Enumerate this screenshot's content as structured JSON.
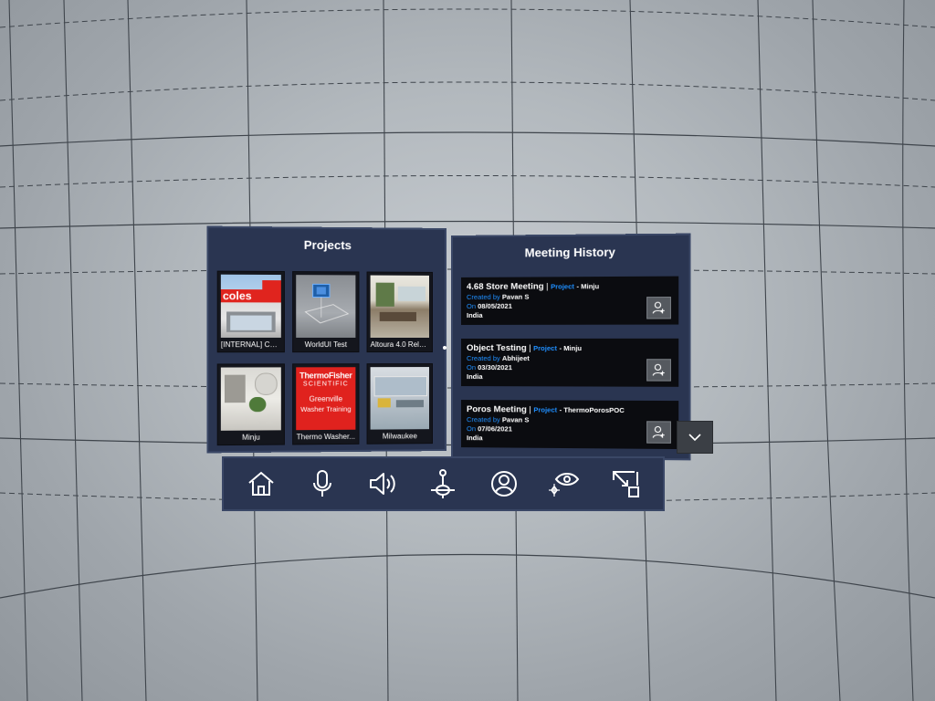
{
  "projects": {
    "title": "Projects",
    "items": [
      {
        "label": "[INTERNAL] Col...",
        "thumb": "coles-store-thumbnail"
      },
      {
        "label": "WorldUI Test",
        "thumb": "worldui-test-thumbnail"
      },
      {
        "label": "Altoura 4.0 Rele...",
        "thumb": "office-interior-thumbnail"
      },
      {
        "label": "Minju",
        "thumb": "room-interior-thumbnail"
      },
      {
        "label": "Thermo Washer...",
        "thumb": "thermo-fisher-thumbnail",
        "logo_line1": "ThermoFisher",
        "logo_line2": "SCIENTIFIC",
        "logo_line3": "Greenville",
        "logo_line4": "Washer Training"
      },
      {
        "label": "Milwaukee",
        "thumb": "office-room-thumbnail"
      }
    ],
    "coles_text": "coles"
  },
  "meetings": {
    "title": "Meeting History",
    "project_label": "Project",
    "created_label": "Created by",
    "on_label": "On",
    "items": [
      {
        "title": "4.68 Store Meeting",
        "project": "Minju",
        "created_by": "Pavan S",
        "date": "08/05/2021",
        "location": "India"
      },
      {
        "title": "Object Testing",
        "project": "Minju",
        "created_by": "Abhijeet",
        "date": "03/30/2021",
        "location": "India"
      },
      {
        "title": "Poros Meeting",
        "project": "ThermoPorosPOC",
        "created_by": "Pavan S",
        "date": "07/06/2021",
        "location": "India"
      }
    ]
  },
  "toolbar": {
    "icons": [
      "home-icon",
      "microphone-icon",
      "speaker-icon",
      "teleport-icon",
      "user-profile-icon",
      "view-icon",
      "resize-icon"
    ]
  },
  "colors": {
    "panel": "#2a3551",
    "accent_blue": "#1f8fff",
    "card": "#0b0c10"
  }
}
